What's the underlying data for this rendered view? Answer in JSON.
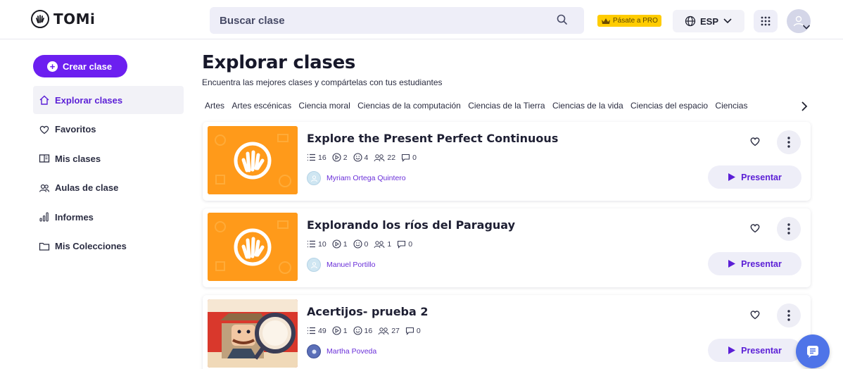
{
  "app": {
    "logo_text": "TOMi"
  },
  "header": {
    "search_placeholder": "Buscar clase",
    "pro_label": "Pásate a PRO",
    "language": "ESP"
  },
  "sidebar": {
    "create_label": "Crear clase",
    "items": [
      {
        "label": "Explorar clases",
        "icon": "home-icon",
        "active": true
      },
      {
        "label": "Favoritos",
        "icon": "heart-icon"
      },
      {
        "label": "Mis clases",
        "icon": "book-icon"
      },
      {
        "label": "Aulas de clase",
        "icon": "users-icon"
      },
      {
        "label": "Informes",
        "icon": "bar-chart-icon"
      },
      {
        "label": "Mis Colecciones",
        "icon": "folder-icon"
      }
    ]
  },
  "main": {
    "title": "Explorar clases",
    "subtitle": "Encuentra las mejores clases y compártelas con tus estudiantes",
    "categories": [
      "Artes",
      "Artes escénicas",
      "Ciencia moral",
      "Ciencias de la computación",
      "Ciencias de la Tierra",
      "Ciencias de la vida",
      "Ciencias del espacio",
      "Ciencias"
    ],
    "present_label": "Presentar",
    "cards": [
      {
        "title": "Explore the Present Perfect Continuous",
        "slides": "16",
        "presentations": "2",
        "reactions": "4",
        "students": "22",
        "comments": "0",
        "author": "Myriam Ortega Quintero",
        "thumb": "tomi-logo"
      },
      {
        "title": "Explorando los ríos del Paraguay",
        "slides": "10",
        "presentations": "1",
        "reactions": "0",
        "students": "1",
        "comments": "0",
        "author": "Manuel Portillo",
        "thumb": "tomi-logo"
      },
      {
        "title": "Acertijos- prueba 2",
        "slides": "49",
        "presentations": "1",
        "reactions": "16",
        "students": "27",
        "comments": "0",
        "author": "Martha Poveda",
        "thumb": "detective"
      }
    ]
  },
  "colors": {
    "brand": "#6c1ff0",
    "pro": "#ffcc00",
    "thumb_orange": "#ff9a1a",
    "chat": "#4f74e8"
  }
}
